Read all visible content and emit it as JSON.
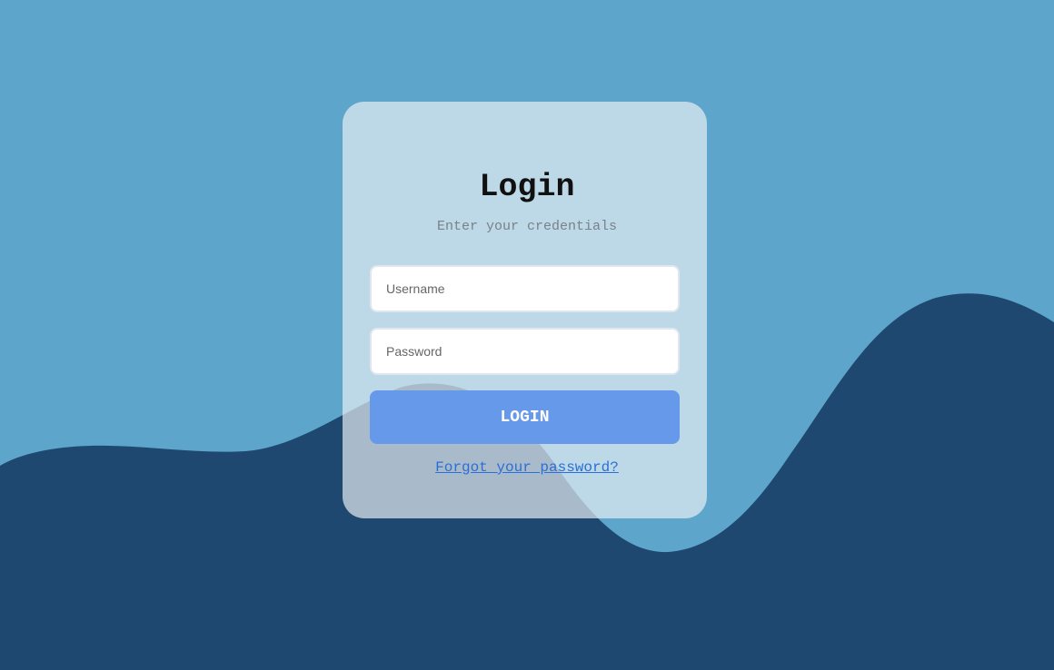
{
  "colors": {
    "background": "#5ea5cb",
    "wave": "#1f4870",
    "card": "#e8eef3",
    "button": "#6699ea",
    "link": "#2a6fd8"
  },
  "login": {
    "title": "Login",
    "subtitle": "Enter your credentials",
    "username_placeholder": "Username",
    "password_placeholder": "Password",
    "submit_label": "LOGIN",
    "forgot_link": "Forgot your password?"
  }
}
